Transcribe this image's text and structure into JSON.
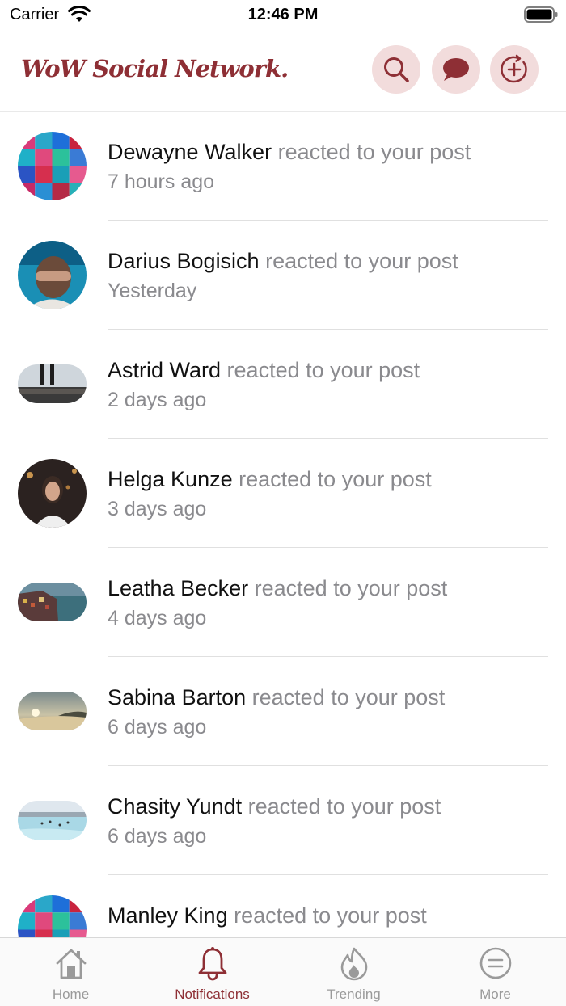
{
  "status_bar": {
    "carrier": "Carrier",
    "time": "12:46 PM"
  },
  "header": {
    "logo": "WoW Social Network.",
    "buttons": [
      {
        "icon": "search-icon"
      },
      {
        "icon": "chat-bubble-icon"
      },
      {
        "icon": "add-circle-icon"
      }
    ]
  },
  "theme": {
    "accent": "#8e2f35",
    "button_bg": "#f2dcdc",
    "secondary_text": "#8a8a8e"
  },
  "notifications": [
    {
      "name": "Dewayne Walker",
      "action": "reacted to your post",
      "time": "7 hours ago"
    },
    {
      "name": "Darius Bogisich",
      "action": "reacted to your post",
      "time": "Yesterday"
    },
    {
      "name": "Astrid Ward",
      "action": "reacted to your post",
      "time": "2 days ago"
    },
    {
      "name": "Helga Kunze",
      "action": "reacted to your post",
      "time": "3 days ago"
    },
    {
      "name": "Leatha Becker",
      "action": "reacted to your post",
      "time": "4 days ago"
    },
    {
      "name": "Sabina Barton",
      "action": "reacted to your post",
      "time": "6 days ago"
    },
    {
      "name": "Chasity Yundt",
      "action": "reacted to your post",
      "time": "6 days ago"
    },
    {
      "name": "Manley King",
      "action": "reacted to your post",
      "time": ""
    }
  ],
  "tab_bar": {
    "tabs": [
      {
        "label": "Home",
        "icon": "home-icon",
        "active": false
      },
      {
        "label": "Notifications",
        "icon": "bell-icon",
        "active": true
      },
      {
        "label": "Trending",
        "icon": "flame-icon",
        "active": false
      },
      {
        "label": "More",
        "icon": "more-icon",
        "active": false
      }
    ]
  }
}
